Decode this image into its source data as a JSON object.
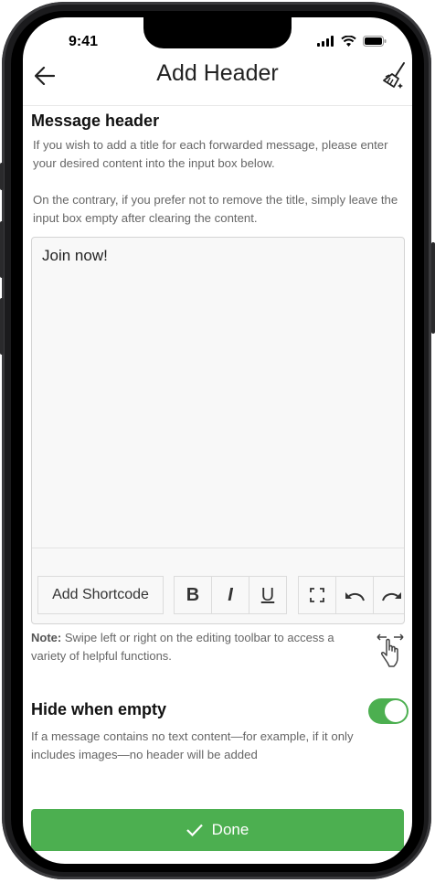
{
  "status": {
    "time": "9:41"
  },
  "appbar": {
    "title": "Add Header"
  },
  "message_header": {
    "title": "Message header",
    "desc1": "If you wish to add a title for each forwarded message, please enter your desired content into the input box below.",
    "desc2": "On the contrary, if you prefer not to remove the title, simply leave the input box empty after clearing the content."
  },
  "editor": {
    "content": "Join now!",
    "toolbar": {
      "shortcode_label": "Add Shortcode",
      "bold_label": "B",
      "italic_label": "I",
      "underline_label": "U"
    }
  },
  "note": {
    "label": "Note:",
    "text": " Swipe left or right on the editing toolbar to access a variety of helpful functions."
  },
  "hide_when_empty": {
    "title": "Hide when empty",
    "enabled": true,
    "desc": "If a message contains no text content—for example, if it only includes images—no header will be added"
  },
  "done": {
    "label": "Done"
  },
  "colors": {
    "accent": "#4caf50",
    "text": "#111111",
    "muted": "#666666"
  }
}
